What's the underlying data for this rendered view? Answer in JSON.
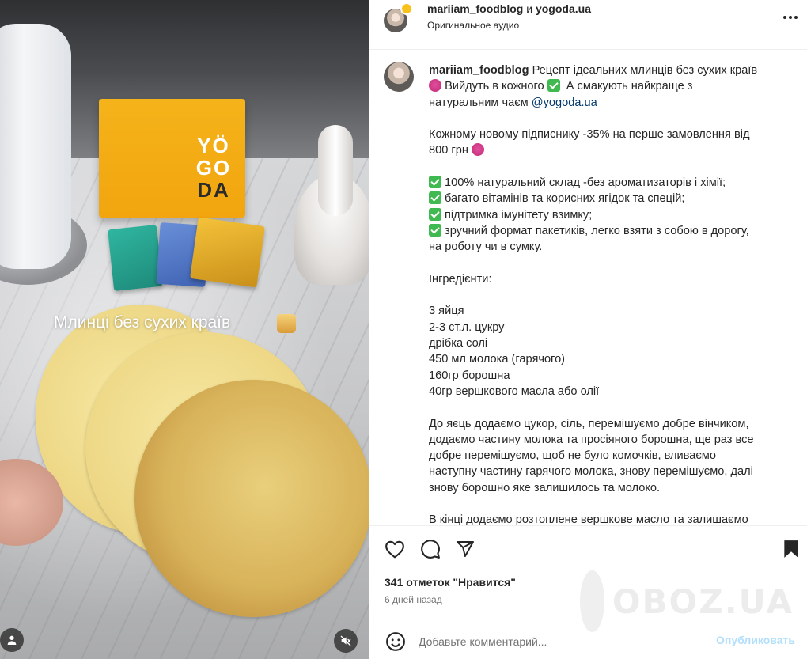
{
  "media": {
    "overlay_caption": "Млинці без сухих країв",
    "box_brand_line1": "YÖ",
    "box_brand_line2": "GO",
    "box_brand_line3": "DA",
    "icons": {
      "user": "user-tag-icon",
      "mute": "speaker-muted-icon"
    }
  },
  "header": {
    "user1": "mariiam_foodblog",
    "conj": "и",
    "user2": "yogoda.ua",
    "audio": "Оригинальное аудио",
    "more_icon": "more-horizontal-icon"
  },
  "caption": {
    "username": "mariiam_foodblog",
    "line1": "Рецепт ідеальних млинців без сухих країв",
    "line2a": "Вийдуть в кожного",
    "line2b": "А смакують найкраще з",
    "line3": "натуральним чаєм",
    "mention": "@yogoda.ua",
    "promo1": "Кожному новому підписнику -35% на перше замовлення від",
    "promo2": "800 грн",
    "bullets": [
      "100% натуральний склад -без ароматизаторів і хімії;",
      "багато вітамінів та корисних ягідок та спецій;",
      "підтримка імунітету взимку;",
      "зручний формат пакетиків, легко взяти з собою в дорогу,"
    ],
    "bullet_cont": "на роботу чи в сумку.",
    "ingredients_title": "Інгредієнти:",
    "ingredients": [
      "3 яйця",
      "2-3 ст.л. цукру",
      "дрібка солі",
      "450 мл молока (гарячого)",
      "160гр борошна",
      "40гр вершкового масла або олії"
    ],
    "method": [
      "До яєць додаємо цукор, сіль, перемішуємо добре вінчиком,",
      "додаємо частину молока та просіяного борошна, ще раз все",
      "добре перемішуємо, щоб не було комочків, вливаємо",
      "наступну частину гарячого молока, знову перемішуємо, далі",
      "знову борошно яке залишилось та молоко."
    ],
    "final": "В кінці додаємо розтоплене вершкове масло та залишаємо"
  },
  "actions": {
    "icons": [
      "heart-icon",
      "comment-icon",
      "share-icon",
      "bookmark-icon"
    ],
    "likes": "341 отметок \"Нравится\"",
    "date": "6 дней назад"
  },
  "comment": {
    "placeholder": "Добавьте комментарий...",
    "post_label": "Опубликовать",
    "emoji_icon": "emoji-icon"
  },
  "watermark": {
    "text": "OBOZ.UA"
  }
}
